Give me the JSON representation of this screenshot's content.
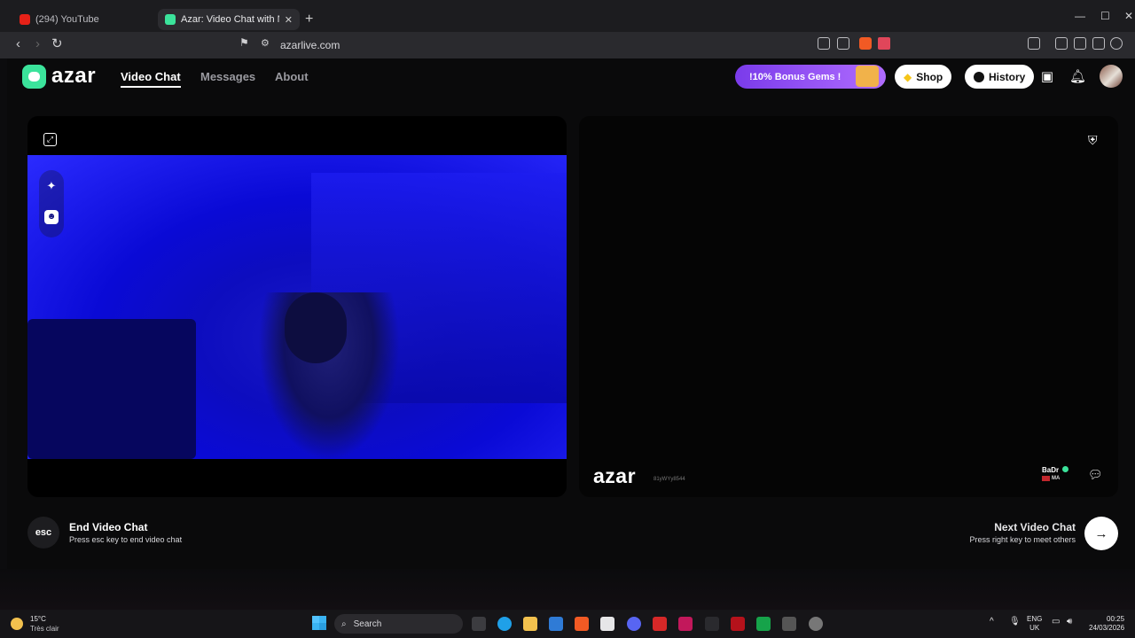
{
  "browser": {
    "tabs": [
      {
        "title": "(294) YouTube",
        "active": false,
        "favicon_color": "#e62117"
      },
      {
        "title": "Azar: Video Chat with New Pe",
        "active": true,
        "favicon_color": "#3be39b"
      }
    ],
    "url": "azarlive.com"
  },
  "header": {
    "logo": "azar",
    "nav": [
      {
        "label": "Video Chat",
        "active": true
      },
      {
        "label": "Messages",
        "active": false
      },
      {
        "label": "About",
        "active": false
      }
    ],
    "promo_label": "10% Bonus Gems",
    "shop_label": "Shop",
    "history_label": "History"
  },
  "video": {
    "watermark": "azar",
    "peer_id": "81yWYy8544",
    "peer_name": "BaDr",
    "peer_country": "MA"
  },
  "controls": {
    "esc_key": "esc",
    "end_title": "End Video Chat",
    "end_hint": "Press esc key to end video chat",
    "next_title": "Next Video Chat",
    "next_hint": "Press right key to meet others"
  },
  "taskbar": {
    "weather_temp": "15°C",
    "weather_desc": "Très clair",
    "search_label": "Search",
    "lang": "ENG",
    "region": "UK",
    "time": "00:25",
    "date": "24/03/2026"
  },
  "colors": {
    "brand": "#3be39b",
    "promo": "#9b55f5",
    "camera_tint": "#1a1ad8"
  }
}
